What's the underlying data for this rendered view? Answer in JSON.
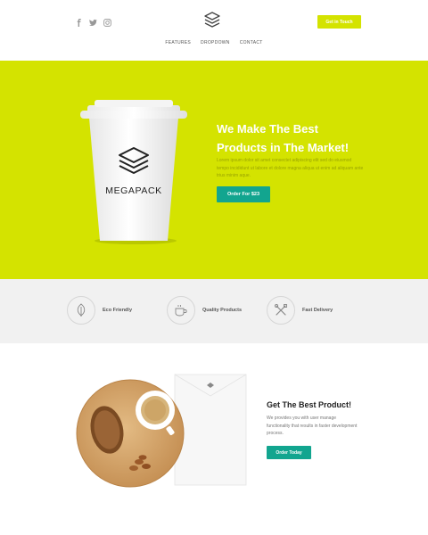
{
  "header": {
    "social_icons": [
      "facebook-icon",
      "twitter-icon",
      "instagram-icon"
    ],
    "logo_icon": "layers-icon",
    "cta_label": "Get in Touch"
  },
  "nav": {
    "items": [
      "FEATURES",
      "DROPDOWN",
      "CONTACT"
    ]
  },
  "hero": {
    "title_line1": "We Make The Best",
    "title_line2": "Products in The Market!",
    "body": "Lorem ipsum dolor sit amet consectet adipiscing elit sed do eiusmod tempo incididunt ut labore et dolore magna aliqua ut enim ad aliquam ante trius minim aque.",
    "button_label": "Order For $23",
    "cup_brand": "MEGAPACK"
  },
  "features": [
    {
      "icon": "leaf-icon",
      "label": "Eco Friendly"
    },
    {
      "icon": "coffee-cup-icon",
      "label": "Quality Products"
    },
    {
      "icon": "tools-icon",
      "label": "Fast Delivery"
    }
  ],
  "product": {
    "title": "Get The Best Product!",
    "body": "We provides you with user manage functionality that results in faster development process.",
    "button_label": "Order Today"
  },
  "colors": {
    "accent_lime": "#d4e300",
    "accent_teal": "#12a58f",
    "features_bg": "#f1f1f1"
  }
}
